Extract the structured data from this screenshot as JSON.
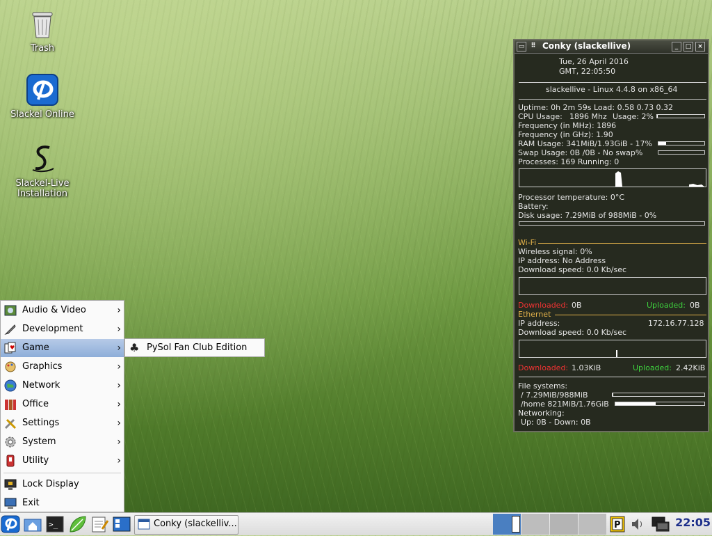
{
  "desktop": {
    "icons": [
      {
        "label": "Trash"
      },
      {
        "label": "Slackel Online"
      },
      {
        "label": "Slackel-Live Installation"
      }
    ]
  },
  "conky": {
    "title": "Conky (slackellive)",
    "date": "Tue,  26 April 2016",
    "time": "GMT,     22:05:50",
    "host": "slackellive - Linux 4.4.8 on x86_64",
    "uptime": "Uptime: 0h 2m 59s Load: 0.58 0.73 0.32",
    "cpu_label": "CPU Usage:",
    "cpu_mhz": "1896 Mhz",
    "cpu_usage": "Usage: 2%",
    "cpu_fraction": 0.02,
    "freq_mhz": "Frequency (in MHz): 1896",
    "freq_ghz": "Frequency (in GHz): 1.90",
    "ram": "RAM Usage: 341MiB/1.93GiB - 17%",
    "ram_fraction": 0.17,
    "swap": "Swap Usage: 0B  /0B   - No swap%",
    "swap_fraction": 0,
    "processes": "Processes: 169  Running: 0",
    "temp": "Processor temperature: 0°C",
    "battery": "Battery:",
    "disk": "Disk usage: 7.29MiB of 988MiB - 0%",
    "disk_fraction": 0,
    "wifi": {
      "header": "Wi-Fi",
      "signal": "Wireless signal: 0%",
      "ip": "IP address: No Address",
      "download": "Download speed: 0.0 Kb/sec",
      "downloaded_label": "Downloaded:",
      "downloaded_value": "0B",
      "uploaded_label": "Uploaded:",
      "uploaded_value": "0B"
    },
    "ethernet": {
      "header": "Ethernet",
      "ip_label": "IP address:",
      "ip_value": "172.16.77.128",
      "download": "Download speed: 0.0 Kb/sec",
      "downloaded_label": "Downloaded:",
      "downloaded_value": "1.03KiB",
      "uploaded_label": "Uploaded:",
      "uploaded_value": "2.42KiB"
    },
    "filesystems": {
      "header": "File systems:",
      "root": "/ 7.29MiB/988MiB",
      "root_fraction": 0.01,
      "home": "/home 821MiB/1.76GiB",
      "home_fraction": 0.45
    },
    "networking": {
      "header": "Networking:",
      "updown": "Up: 0B    - Down: 0B"
    }
  },
  "menu": {
    "items": [
      {
        "label": "Audio & Video"
      },
      {
        "label": "Development"
      },
      {
        "label": "Game"
      },
      {
        "label": "Graphics"
      },
      {
        "label": "Network"
      },
      {
        "label": "Office"
      },
      {
        "label": "Settings"
      },
      {
        "label": "System"
      },
      {
        "label": "Utility"
      }
    ],
    "lock_label": "Lock Display",
    "exit_label": "Exit",
    "submenu_item": "PySol Fan Club Edition"
  },
  "taskbar": {
    "window_button": "Conky (slackelliv...",
    "clock": "22:05"
  },
  "colors": {
    "conky_bg": "#262a1f",
    "accent_orange": "#e3b24a",
    "download_red": "#e33333",
    "upload_green": "#3ed13e",
    "menu_highlight": "#8eaed9",
    "clock": "#1d2f8a"
  }
}
